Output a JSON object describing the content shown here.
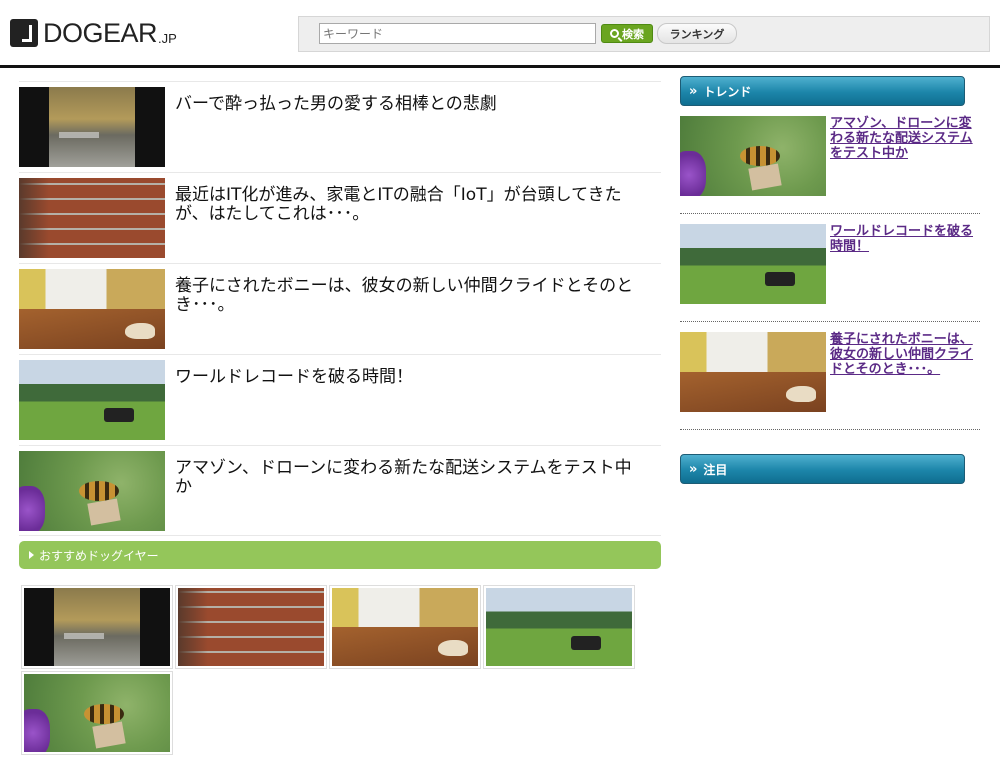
{
  "header": {
    "logo_text": "DOGEAR",
    "logo_suffix": ".JP",
    "search_placeholder": "キーワード",
    "search_button": "検索",
    "ranking_button": "ランキング"
  },
  "articles": [
    {
      "title": "バーで酔っ払った男の愛する相棒との悲劇",
      "thumb": "bar"
    },
    {
      "title": "最近はIT化が進み、家電とITの融合「IoT」が台頭してきたが、はたしてこれは･･･。",
      "thumb": "brick"
    },
    {
      "title": "養子にされたボニーは、彼女の新しい仲間クライドとそのとき･･･。",
      "thumb": "room"
    },
    {
      "title": "ワールドレコードを破る時間！",
      "thumb": "field"
    },
    {
      "title": "アマゾン、ドローンに変わる新たな配送システムをテスト中か",
      "thumb": "bee"
    }
  ],
  "recommend": {
    "label": "おすすめドッグイヤー"
  },
  "sidebar": {
    "trend_label": "トレンド",
    "trend_items": [
      {
        "title": "アマゾン、ドローンに変わる新たな配送システムをテスト中か",
        "thumb": "bee"
      },
      {
        "title": "ワールドレコードを破る時間！",
        "thumb": "field"
      },
      {
        "title": "養子にされたボニーは、彼女の新しい仲間クライドとそのとき･･･。",
        "thumb": "room"
      }
    ],
    "featured_label": "注目"
  },
  "colors": {
    "accent_green": "#94c65a",
    "search_green": "#6aa520",
    "sidebar_blue": "#1c85a9",
    "link_purple": "#5b2a86"
  }
}
